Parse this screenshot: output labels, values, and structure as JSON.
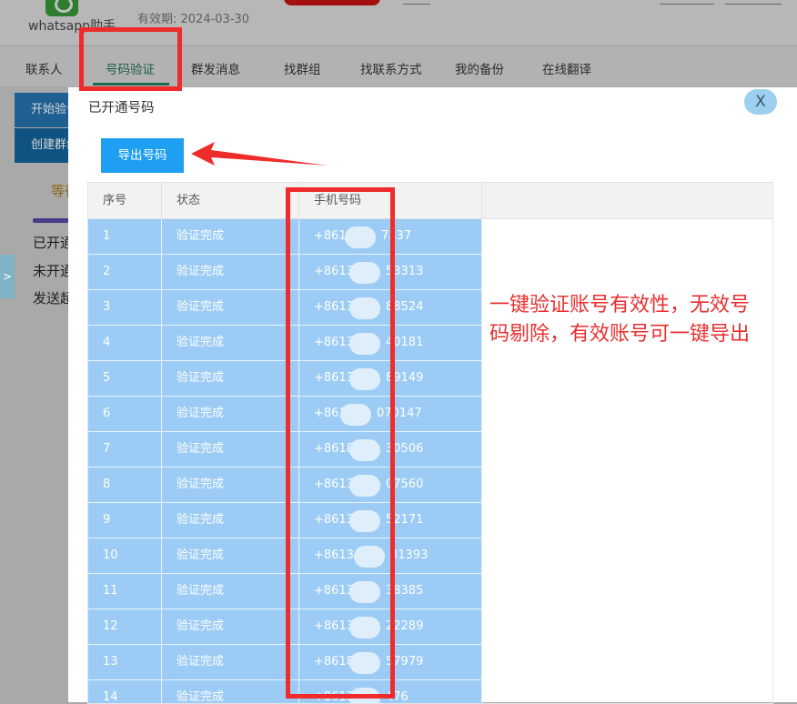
{
  "app": {
    "name": "whatsapp助手",
    "validity": "有效期: 2024-03-30"
  },
  "nav": {
    "items": [
      {
        "label": "联系人"
      },
      {
        "label": "号码验证"
      },
      {
        "label": "群发消息"
      },
      {
        "label": "找群组"
      },
      {
        "label": "找联系方式"
      },
      {
        "label": "我的备份"
      },
      {
        "label": "在线翻译"
      }
    ]
  },
  "sidebar": {
    "btn1": "开始验证",
    "btn2": "创建群组",
    "status": "等待",
    "list": [
      "已开通",
      "未开通",
      "发送超"
    ],
    "toggle": ">"
  },
  "modal": {
    "title": "已开通号码",
    "close": "X",
    "export_button": "导出号码",
    "columns": [
      "序号",
      "状态",
      "手机号码"
    ],
    "rows": [
      {
        "no": "1",
        "status": "验证完成",
        "phone": "+861",
        "tail": "7337"
      },
      {
        "no": "2",
        "status": "验证完成",
        "phone": "+8613",
        "tail": "53313"
      },
      {
        "no": "3",
        "status": "验证完成",
        "phone": "+8613",
        "tail": "88524"
      },
      {
        "no": "4",
        "status": "验证完成",
        "phone": "+8613",
        "tail": "40181"
      },
      {
        "no": "5",
        "status": "验证完成",
        "phone": "+8613",
        "tail": "89149"
      },
      {
        "no": "6",
        "status": "验证完成",
        "phone": "+861",
        "tail": "070147"
      },
      {
        "no": "7",
        "status": "验证完成",
        "phone": "+8618",
        "tail": "30506"
      },
      {
        "no": "8",
        "status": "验证完成",
        "phone": "+8613",
        "tail": "07560"
      },
      {
        "no": "9",
        "status": "验证完成",
        "phone": "+8613",
        "tail": "52171"
      },
      {
        "no": "10",
        "status": "验证完成",
        "phone": "+8613",
        "tail": "31393"
      },
      {
        "no": "11",
        "status": "验证完成",
        "phone": "+8613",
        "tail": "38385"
      },
      {
        "no": "12",
        "status": "验证完成",
        "phone": "+8613",
        "tail": "22289"
      },
      {
        "no": "13",
        "status": "验证完成",
        "phone": "+8618",
        "tail": "57979"
      },
      {
        "no": "14",
        "status": "验证完成",
        "phone": "+8613",
        "tail": "476"
      }
    ]
  },
  "annotation": {
    "line1": "一键验证账号有效性，无效号",
    "line2": "码剔除，有效账号可一键导出"
  },
  "colors": {
    "accent": "#1e9ff2",
    "row_selected": "#9cccf6",
    "annotation_red": "#ef2b2b"
  }
}
